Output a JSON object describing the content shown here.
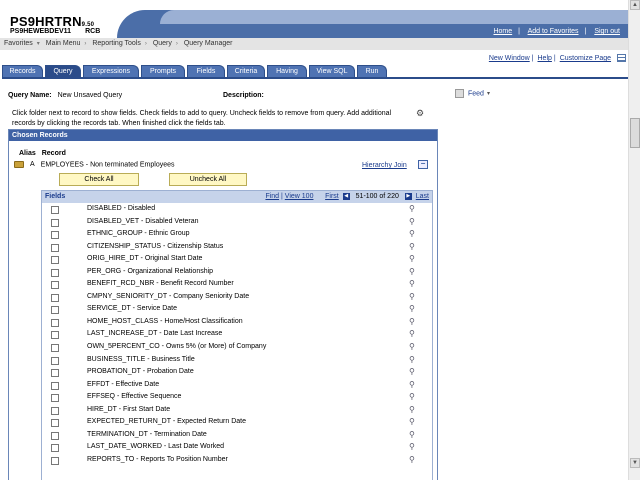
{
  "header": {
    "app_name": "PS9HRTRN",
    "app_version": "9.50",
    "db_name": "PS9HEWEBDEV11",
    "db_user": "RCB",
    "links": [
      "Home",
      "Add to Favorites",
      "Sign out"
    ]
  },
  "breadcrumbs": [
    "Favorites",
    "Main Menu",
    "Reporting Tools",
    "Query",
    "Query Manager"
  ],
  "top_links": [
    "New Window",
    "Help",
    "Customize Page"
  ],
  "tabs": [
    "Records",
    "Query",
    "Expressions",
    "Prompts",
    "Fields",
    "Criteria",
    "Having",
    "View SQL",
    "Run"
  ],
  "active_tab": "Query",
  "query": {
    "name_label": "Query Name:",
    "name_value": "New Unsaved Query",
    "desc_label": "Description:",
    "feed_label": "Feed",
    "instructions": "Click folder next to record to show fields. Check fields to add to query. Uncheck fields to remove from query. Add additional records by clicking the records tab. When finished click the fields tab."
  },
  "chosen": {
    "title": "Chosen Records",
    "alias_header": "Alias",
    "record_header": "Record",
    "alias": "A",
    "record": "EMPLOYEES - Non terminated Employees",
    "hierarchy_join": "Hierarchy Join",
    "check_all": "Check All",
    "uncheck_all": "Uncheck All"
  },
  "fields_grid": {
    "title": "Fields",
    "find": "Find",
    "view": "View 100",
    "first": "First",
    "page": "51-100 of 220",
    "last": "Last",
    "rows": [
      "DISABLED - Disabled",
      "DISABLED_VET - Disabled Veteran",
      "ETHNIC_GROUP - Ethnic Group",
      "CITIZENSHIP_STATUS - Citizenship Status",
      "ORIG_HIRE_DT - Original Start Date",
      "PER_ORG - Organizational Relationship",
      "BENEFIT_RCD_NBR - Benefit Record Number",
      "CMPNY_SENIORITY_DT - Company Seniority Date",
      "SERVICE_DT - Service Date",
      "HOME_HOST_CLASS - Home/Host Classification",
      "LAST_INCREASE_DT - Date Last Increase",
      "OWN_5PERCENT_CO - Owns 5% (or More) of Company",
      "BUSINESS_TITLE - Business Title",
      "PROBATION_DT - Probation Date",
      "EFFDT - Effective Date",
      "EFFSEQ - Effective Sequence",
      "HIRE_DT - First Start Date",
      "EXPECTED_RETURN_DT - Expected Return Date",
      "TERMINATION_DT - Termination Date",
      "LAST_DATE_WORKED - Last Date Worked",
      "REPORTS_TO - Reports To Position Number"
    ]
  },
  "colors": {
    "accent": "#3f62a5",
    "tab_active": "#2b4c8a",
    "button_bg": "#fff8c4"
  }
}
